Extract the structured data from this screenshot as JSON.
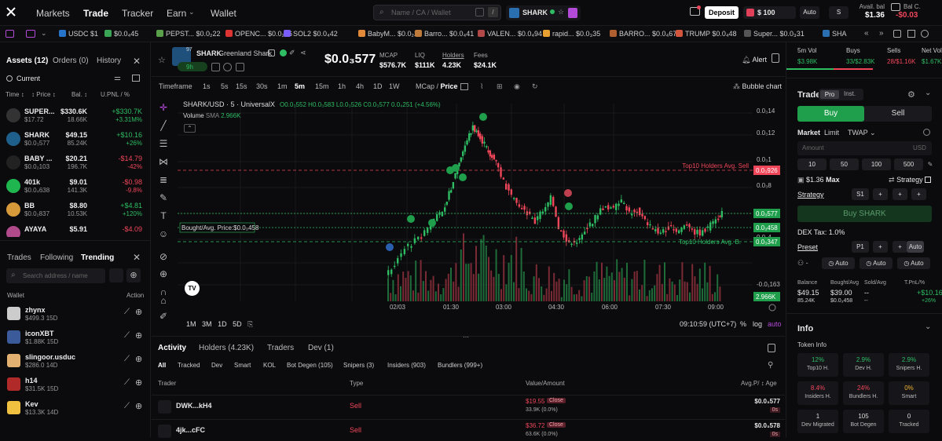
{
  "nav": {
    "items": [
      "Markets",
      "Trade",
      "Tracker",
      "Earn",
      "Wallet"
    ],
    "search_placeholder": "Name / CA / Wallet",
    "search_kbd": "/",
    "token_pill": "SHARK",
    "deposit": "Deposit",
    "balance": "$ 100",
    "auto": "Auto",
    "s": "S",
    "avail_label": "Avail. bal",
    "avail_value": "$1.36",
    "balc_label": "Bal C.",
    "balc_value": "-$0.03"
  },
  "ticker": [
    {
      "label": "USDC $1",
      "color": "#2775ca"
    },
    {
      "label": "$0.0₄45",
      "color": "#3aa655"
    },
    {
      "label": "PEPST... $0.0₂22",
      "color": "#5aa04a"
    },
    {
      "label": "OPENC... $0.0₂76",
      "color": "#d33"
    },
    {
      "label": "SOL2 $0.0₄42",
      "color": "#7a5cff"
    },
    {
      "label": "BabyM... $0.0₂25",
      "color": "#e3893a"
    },
    {
      "label": "Barro... $0.0₄41",
      "color": "#c07a3a"
    },
    {
      "label": "VALEN... $0.0₄94",
      "color": "#b24848"
    },
    {
      "label": "rapid... $0.0₃35",
      "color": "#e8a030"
    },
    {
      "label": "BARRO... $0.0₄67",
      "color": "#b06030"
    },
    {
      "label": "TRUMP $0.0₄48",
      "color": "#d2553c"
    },
    {
      "label": "Super... $0.0₃31",
      "color": "#555"
    },
    {
      "label": "SHA",
      "color": "#2a6fb0"
    }
  ],
  "left": {
    "tabs": [
      "Assets (12)",
      "Orders (0)",
      "History"
    ],
    "filter": "Current",
    "cols": [
      "Time",
      "Price",
      "Bal.",
      "U.PNL / %"
    ],
    "assets": [
      {
        "name": "SUPER...",
        "price": "$17.72",
        "value": "$330.6K",
        "bal": "18.66K",
        "pnl": "+$330.7K",
        "pct": "+3.31M%",
        "up": true,
        "color": "#333"
      },
      {
        "name": "SHARK",
        "price": "$0.0₃577",
        "value": "$49.15",
        "bal": "85.24K",
        "pnl": "+$10.16",
        "pct": "+26%",
        "up": true,
        "color": "#1f5f8b"
      },
      {
        "name": "BABY ...",
        "price": "$0.0₂103",
        "value": "$20.21",
        "bal": "196.7K",
        "pnl": "-$14.79",
        "pct": "-42%",
        "up": false,
        "color": "#222"
      },
      {
        "name": "401k",
        "price": "$0.0₄638",
        "value": "$9.01",
        "bal": "141.3K",
        "pnl": "-$0.98",
        "pct": "-9.8%",
        "up": false,
        "color": "#1fb54f"
      },
      {
        "name": "BB",
        "price": "$0.0₂837",
        "value": "$8.80",
        "bal": "10.53K",
        "pnl": "+$4.81",
        "pct": "+120%",
        "up": true,
        "color": "#d79a3a"
      },
      {
        "name": "AYAYA",
        "price": "",
        "value": "$5.91",
        "bal": "",
        "pnl": "-$4.09",
        "pct": "",
        "up": false,
        "color": "#b04a8a"
      }
    ],
    "trade_tabs": [
      "Trades",
      "Following",
      "Trending"
    ],
    "wallet_search": "Search address / name",
    "wallet_header": "Wallet",
    "action_header": "Action",
    "wallets": [
      {
        "name": "zhynx",
        "bal": "$499.3",
        "age": "15D",
        "color": "#ccc"
      },
      {
        "name": "iconXBT",
        "bal": "$1.88K",
        "age": "15D",
        "color": "#3a5a9a"
      },
      {
        "name": "slingoor.usduc",
        "bal": "$286.0",
        "age": "14D",
        "color": "#e2b070"
      },
      {
        "name": "h14",
        "bal": "$31.5K",
        "age": "15D",
        "color": "#b02a2a"
      },
      {
        "name": "Kev",
        "bal": "$13.3K",
        "age": "14D",
        "color": "#f0c040"
      }
    ]
  },
  "header": {
    "rank": "97",
    "name": "SHARK",
    "fullname": "Greenland Shark",
    "age": "9h",
    "price": "$0.0₃577",
    "stats": [
      {
        "label": "MCAP",
        "value": "$576.7K"
      },
      {
        "label": "LIQ",
        "value": "$111K"
      },
      {
        "label": "Holders",
        "value": "4.23K"
      },
      {
        "label": "Fees",
        "value": "$24.1K"
      }
    ],
    "alert": "Alert"
  },
  "chartbar": {
    "timeframe": "Timeframe",
    "tfs": [
      "1s",
      "5s",
      "15s",
      "30s",
      "1m",
      "5m",
      "15m",
      "1h",
      "4h",
      "1D",
      "1W"
    ],
    "active_tf": "5m",
    "mcap": "MCap",
    "price": "Price",
    "bubble": "Bubble chart"
  },
  "chart": {
    "legend": "SHARK/USD · 5 · UniversalX",
    "ohlc": "O0.0₃552 H0.0₃583 L0.0₃526 C0.0₃577 0.0₄251 (+4.56%)",
    "volume": "Volume",
    "sma": "SMA",
    "volval": "2.966K",
    "top10_sell": "Top10 Holders Avg. Sell",
    "top10_buy": "Top10 Holders Avg. B.",
    "bought_avg": "Bought/Avg. Price:$0.0₃458",
    "price_labels": [
      "0.0₃14",
      "0.0₃12",
      "0.0₃1",
      "0.0₃8",
      "0.0₃6",
      "0.0₃4",
      "-0.0₁163"
    ],
    "badges": {
      "sell": "0.0₃926",
      "cur": "0.0₃577",
      "bought": "0.0₃458",
      "buy": "0.0₃347",
      "vol": "2.966K"
    },
    "times": [
      "02/03",
      "01:30",
      "03:00",
      "04:30",
      "06:00",
      "07:30",
      "09:00"
    ],
    "bottom_ranges": [
      "1M",
      "3M",
      "1D",
      "5D"
    ],
    "clock": "09:10:59 (UTC+7)",
    "pct": "%",
    "log": "log",
    "auto": "auto"
  },
  "bottom": {
    "tabs": [
      "Activity",
      "Holders (4.23K)",
      "Traders",
      "Dev (1)"
    ],
    "filters": [
      "All",
      "Tracked",
      "Dev",
      "Smart",
      "KOL",
      "Bot Degen (105)",
      "Snipers (3)",
      "Insiders (903)",
      "Bundlers (999+)"
    ],
    "cols": {
      "trader": "Trader",
      "type": "Type",
      "value": "Value/Amount",
      "avg": "Avg.P/",
      "age": "Age"
    },
    "rows": [
      {
        "trader": "DWK...kH4",
        "type": "Sell",
        "value": "$19.55",
        "amount": "33.9K (0.0%)",
        "close": "Close",
        "avg": "$0.0₃577",
        "age": "0s"
      },
      {
        "trader": "4jk...cFC",
        "type": "Sell",
        "value": "$36.72",
        "amount": "63.6K (0.0%)",
        "close": "Close",
        "avg": "$0.0₃578",
        "age": "0s"
      }
    ]
  },
  "right": {
    "vols": [
      {
        "label": "5m Vol",
        "value": "$3.98K"
      },
      {
        "label": "Buys",
        "value": "33/$2.83K"
      },
      {
        "label": "Sells",
        "value": "28/$1.16K"
      },
      {
        "label": "Net Vol",
        "value": "$1.67K"
      }
    ],
    "trade": "Trade",
    "pro": "Pro",
    "inst": "Inst.",
    "buy": "Buy",
    "sell": "Sell",
    "order_types": [
      "Market",
      "Limit",
      "TWAP"
    ],
    "amount": "Amount",
    "usd": "USD",
    "amounts": [
      "10",
      "50",
      "100",
      "500"
    ],
    "max_bal": "$1.36",
    "max": "Max",
    "strategy_chk": "Strategy",
    "strategy": "Strategy",
    "s1": "S1",
    "buy_btn": "Buy SHARK",
    "dex_tax": "DEX Tax: ",
    "dex_val": "1.0%",
    "preset": "Preset",
    "p1": "P1",
    "preset_auto": "Auto",
    "autos": [
      "Auto",
      "Auto",
      "Auto"
    ],
    "pos_labels": [
      "Balance",
      "Bought/Avg",
      "Sold/Avg",
      "T.PnL/%"
    ],
    "pos_vals": [
      "$49.15",
      "$39.00",
      "--",
      "+$10.16"
    ],
    "pos_sub": [
      "85.24K",
      "$0.0₃458",
      "--",
      "+26%"
    ],
    "info": "Info",
    "token_info": "Token Info",
    "cards": [
      {
        "a": "12%",
        "b": "Top10 H.",
        "c": "grn"
      },
      {
        "a": "2.9%",
        "b": "Dev H.",
        "c": "grn"
      },
      {
        "a": "2.9%",
        "b": "Snipers H.",
        "c": "grn"
      },
      {
        "a": "8.4%",
        "b": "Insiders H.",
        "c": "red"
      },
      {
        "a": "24%",
        "b": "Bundlers H.",
        "c": "red"
      },
      {
        "a": "0%",
        "b": "Smart",
        "c": "yel"
      },
      {
        "a": "1",
        "b": "Dev Migrated",
        "c": "wht"
      },
      {
        "a": "105",
        "b": "Bot Degen",
        "c": "wht"
      },
      {
        "a": "0",
        "b": "Tracked",
        "c": "wht"
      }
    ]
  }
}
